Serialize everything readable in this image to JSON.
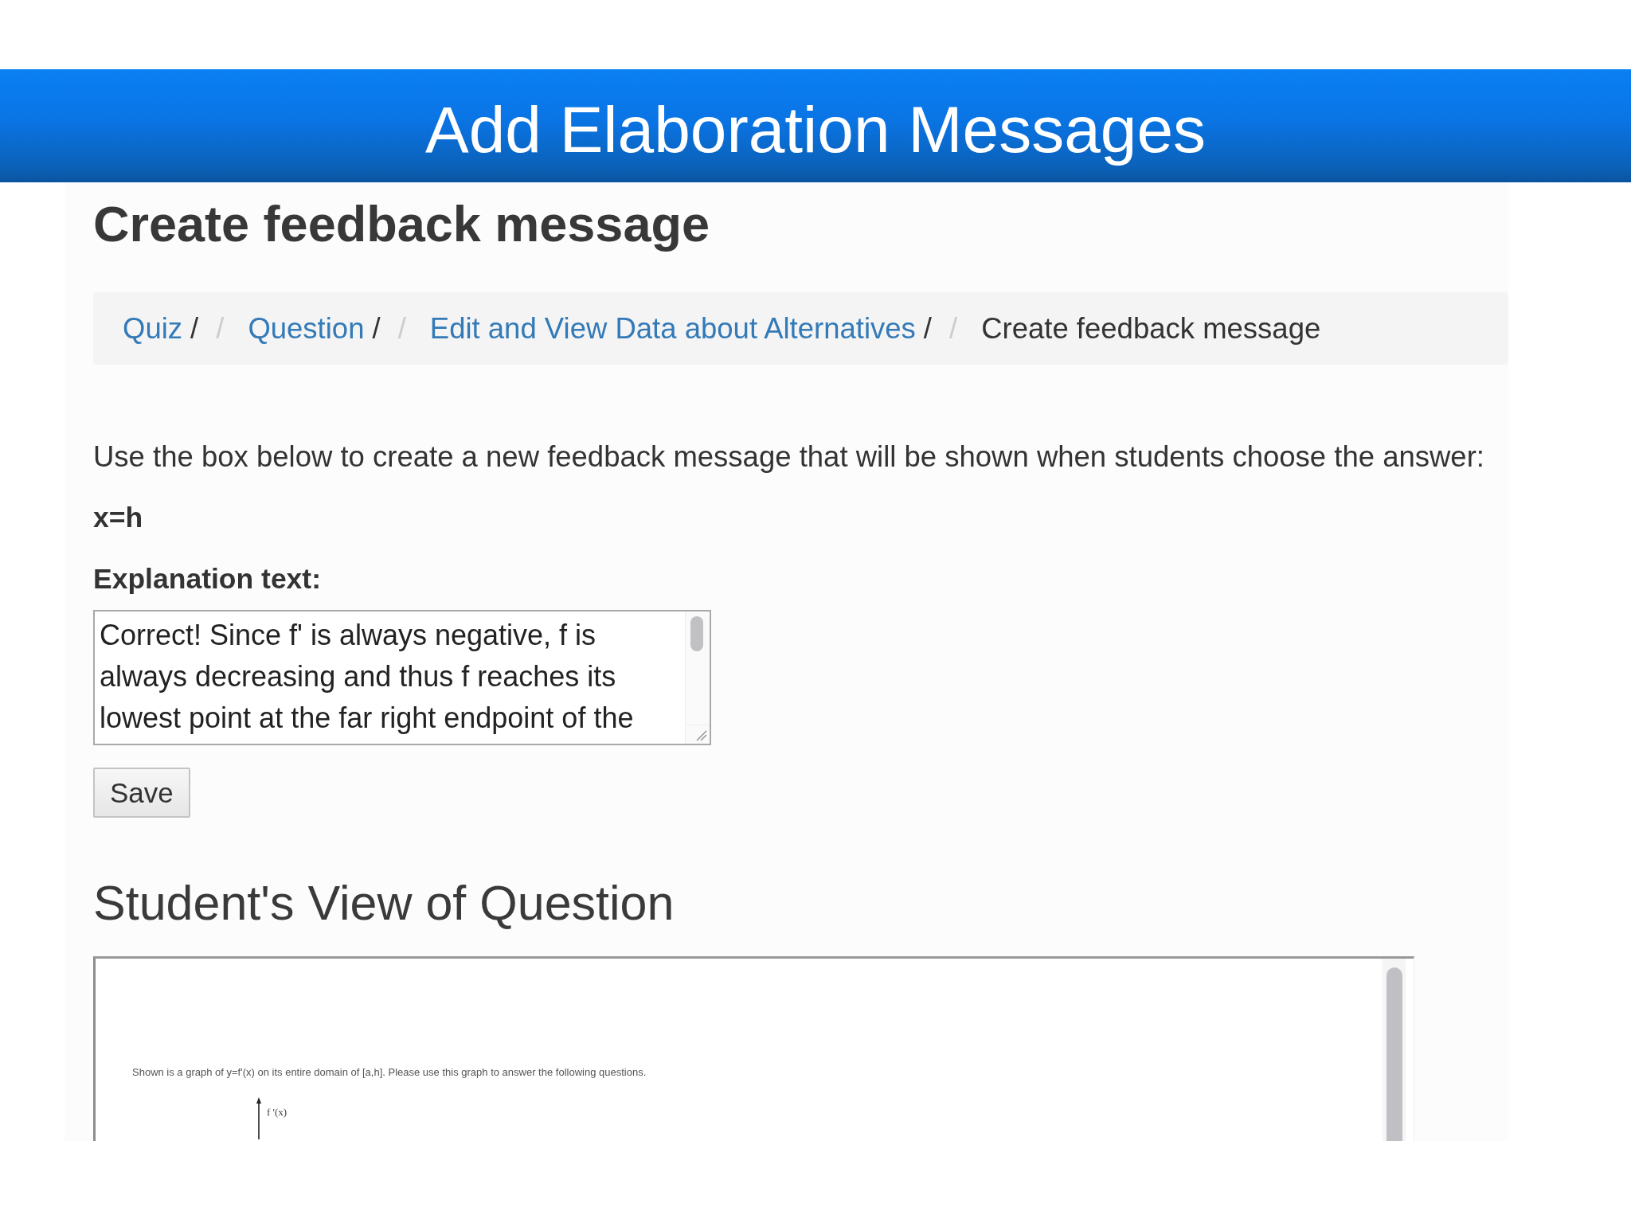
{
  "slide_title": "Add Elaboration Messages",
  "page": {
    "heading": "Create feedback message",
    "breadcrumb": [
      {
        "label": "Quiz",
        "trail": "/",
        "separator": "/",
        "active": false
      },
      {
        "label": "Question",
        "trail": "/",
        "separator": "/",
        "active": false
      },
      {
        "label": "Edit and View Data about Alternatives",
        "trail": "/",
        "separator": "/",
        "active": false
      },
      {
        "label": "Create feedback message",
        "active": true
      }
    ],
    "instruction": "Use the box below to create a new feedback message that will be shown when students choose the answer:",
    "answer": "x=h",
    "explanation_label": "Explanation text:",
    "explanation_field": {
      "value": "Correct! Since f' is always negative, f is always decreasing and thus f reaches its lowest point at the far right endpoint of the"
    },
    "save_button": "Save",
    "preview_heading": "Student's View of Question",
    "preview": {
      "question_text": "Shown is a graph of y=f'(x) on its entire domain of [a,h]. Please use this graph to answer the following questions.",
      "graph_axis_label": "f '(x)"
    }
  }
}
